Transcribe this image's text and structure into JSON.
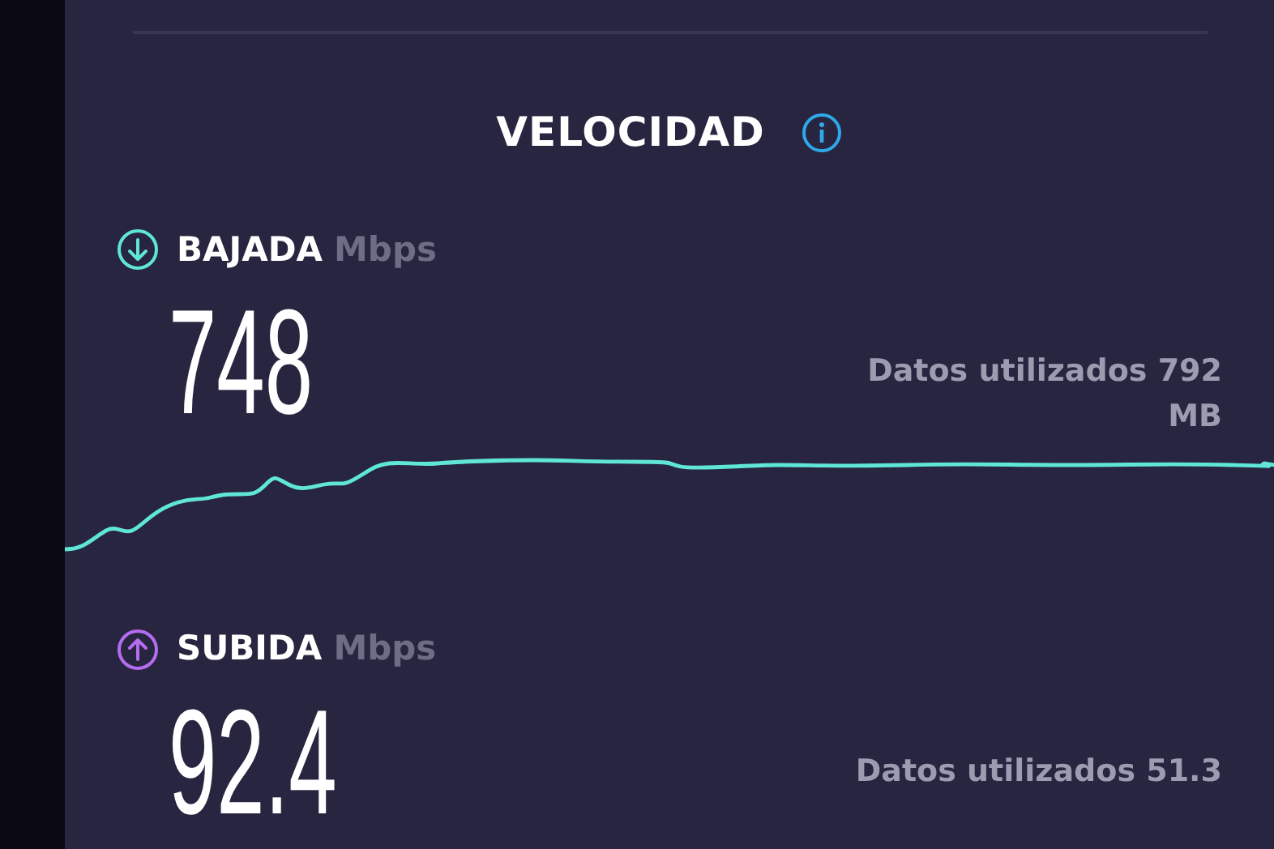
{
  "title": "VELOCIDAD",
  "sections": [
    {
      "kind": "download",
      "label": "BAJADA",
      "unit": "Mbps",
      "value": "748",
      "data_used": "Datos utilizados 792 MB"
    },
    {
      "kind": "upload",
      "label": "SUBIDA",
      "unit": "Mbps",
      "value": "92.4",
      "data_used": "Datos utilizados 51.3"
    }
  ]
}
